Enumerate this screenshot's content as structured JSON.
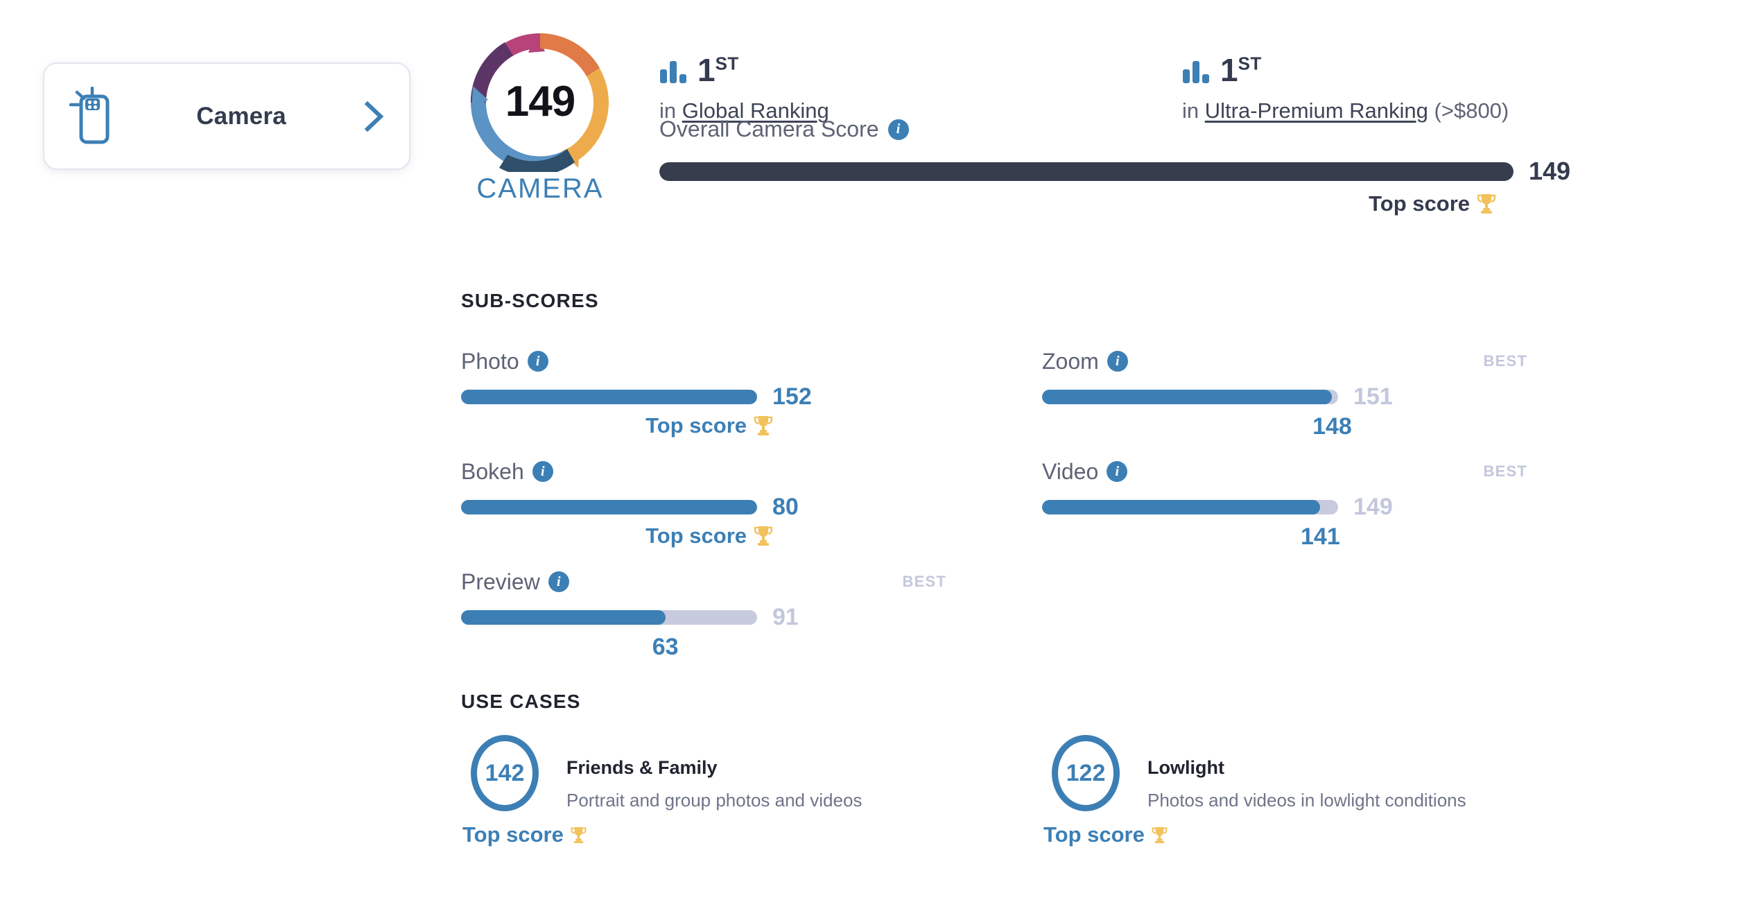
{
  "colors": {
    "accent_blue": "#3c7fb5",
    "dark_navy": "#343b4f",
    "overall_bar": "#373d4d",
    "track_gray": "#c7cbdd",
    "best_gray": "#c3c7dd",
    "trophy_gold": "#f2c25c",
    "logo_pink": "#b8427a",
    "logo_purple": "#5b3566",
    "logo_orange": "#e98a4a",
    "logo_amber": "#eeab4c",
    "logo_blue": "#5a93c4",
    "logo_dark_blue": "#2f4f6b"
  },
  "sidebar": {
    "card": {
      "label": "Camera",
      "icon": "phone-camera-icon",
      "chevron": "chevron-right-icon"
    }
  },
  "header": {
    "brand": {
      "score": "149",
      "word": "CAMERA"
    },
    "rankings": [
      {
        "icon": "bar-chart-icon",
        "place": "1",
        "place_ordinal": "ST",
        "prefix": "in",
        "link": "Global Ranking",
        "suffix": ""
      },
      {
        "icon": "bar-chart-icon",
        "place": "1",
        "place_ordinal": "ST",
        "prefix": "in",
        "link": "Ultra-Premium Ranking",
        "suffix": "(>$800)"
      }
    ],
    "overall": {
      "label": "Overall Camera Score",
      "info_icon": "info-icon",
      "value": "149",
      "fill_percent": 100,
      "top_score_label": "Top score",
      "trophy_icon": "trophy-icon"
    }
  },
  "sub_scores": {
    "title": "SUB-SCORES",
    "best_label": "BEST",
    "top_score_label": "Top score",
    "left": [
      {
        "name": "Photo",
        "info_icon": "info-icon",
        "value": "152",
        "fill_percent": 100,
        "is_top": true,
        "best": null
      },
      {
        "name": "Bokeh",
        "info_icon": "info-icon",
        "value": "80",
        "fill_percent": 100,
        "is_top": true,
        "best": null
      },
      {
        "name": "Preview",
        "info_icon": "info-icon",
        "value": "63",
        "fill_percent": 69,
        "is_top": false,
        "best": "91"
      }
    ],
    "right": [
      {
        "name": "Zoom",
        "info_icon": "info-icon",
        "value": "148",
        "fill_percent": 98,
        "is_top": false,
        "best": "151"
      },
      {
        "name": "Video",
        "info_icon": "info-icon",
        "value": "141",
        "fill_percent": 94,
        "is_top": false,
        "best": "149"
      }
    ]
  },
  "use_cases": {
    "title": "USE CASES",
    "top_score_label": "Top score",
    "items": [
      {
        "score": "142",
        "title": "Friends & Family",
        "description": "Portrait and group photos and videos",
        "is_top": true
      },
      {
        "score": "122",
        "title": "Lowlight",
        "description": "Photos and videos in lowlight conditions",
        "is_top": true
      }
    ]
  },
  "chart_data": {
    "type": "bar",
    "title": "Overall Camera Score",
    "categories": [
      "Overall",
      "Photo",
      "Bokeh",
      "Preview",
      "Zoom",
      "Video",
      "Friends & Family",
      "Lowlight"
    ],
    "values": [
      149,
      152,
      80,
      63,
      148,
      141,
      142,
      122
    ],
    "best_values": [
      149,
      152,
      80,
      91,
      151,
      149,
      null,
      null
    ],
    "xlabel": "",
    "ylabel": "Score",
    "grid": false,
    "legend": "none"
  }
}
